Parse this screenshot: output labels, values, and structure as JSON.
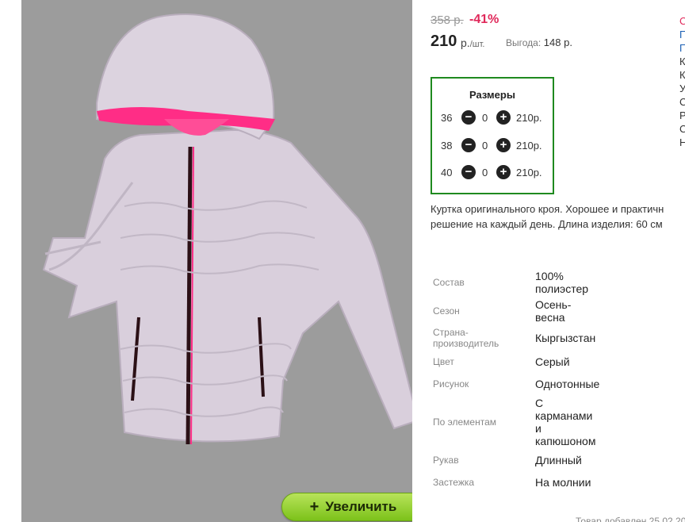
{
  "product": {
    "old_price": "358 р.",
    "discount": "-41%",
    "price": "210",
    "price_unit": "р.",
    "price_unit_suffix": "/шт.",
    "benefit_label": "Выгода:",
    "benefit_value": "148 р.",
    "zoom_label": "Увеличить",
    "zoom_icon": "plus-icon"
  },
  "sizes": {
    "title": "Размеры",
    "rows": [
      {
        "size": "36",
        "qty": "0",
        "sum": "210р."
      },
      {
        "size": "38",
        "qty": "0",
        "sum": "210р."
      },
      {
        "size": "40",
        "qty": "0",
        "sum": "210р."
      }
    ]
  },
  "description": {
    "line1": "Куртка оригинального кроя. Хорошее и практичн",
    "line2": "решение на каждый день. Длина изделия: 60 см"
  },
  "attributes": [
    {
      "label": "Состав",
      "value": "100% полиэстер"
    },
    {
      "label": "Сезон",
      "value": "Осень-весна"
    },
    {
      "label": "Страна-производитель",
      "value": "Кыргызстан"
    },
    {
      "label": "Цвет",
      "value": "Серый"
    },
    {
      "label": "Рисунок",
      "value": "Однотонные"
    },
    {
      "label": "По элементам",
      "value": "С карманами и капюшоном"
    },
    {
      "label": "Рукав",
      "value": "Длинный"
    },
    {
      "label": "Застежка",
      "value": "На молнии"
    }
  ],
  "right_edge_fragments": [
    "С",
    "П",
    "П",
    "К",
    "К",
    "У",
    "С",
    "Р",
    "С",
    "Н"
  ],
  "footer_added": "Товар добавлен 25.02.20",
  "colors": {
    "accent_green": "#1f8a1f",
    "discount_red": "#e0285a",
    "button_green": "#8bd12a",
    "photo_bg": "#9c9c9c"
  }
}
